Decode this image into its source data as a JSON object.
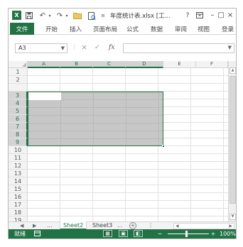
{
  "window": {
    "title": "年度统计表.xlsx [工...",
    "help": "?",
    "minimize": "–",
    "restore": "□",
    "close": "×"
  },
  "quick_access": {
    "logo": "X"
  },
  "ribbon": {
    "tabs": [
      "文件",
      "开始",
      "插入",
      "页面布局",
      "公式",
      "数据",
      "审阅",
      "视图",
      "登录"
    ]
  },
  "formula_bar": {
    "name_box": "A3",
    "cancel": "×",
    "enter": "✓",
    "fx": "fx",
    "formula_value": ""
  },
  "grid": {
    "columns": [
      "A",
      "B",
      "C",
      "D",
      "E",
      "F"
    ],
    "rows": [
      "1",
      "2",
      "3",
      "4",
      "5",
      "6",
      "7",
      "8",
      "9",
      "10",
      "11",
      "12",
      "13",
      "14",
      "15",
      "16",
      "17",
      "18",
      "19"
    ],
    "selected_range": "A3:D9",
    "active_cell": "A3"
  },
  "sheets": {
    "nav_prev": "◀",
    "nav_next": "▶",
    "more_left": "...",
    "tabs": [
      "Sheet2",
      "Sheet3"
    ],
    "more_right": "...",
    "active": "Sheet2",
    "add": "+"
  },
  "status": {
    "text": "就绪",
    "zoom_minus": "−",
    "zoom_plus": "+",
    "zoom": "100%",
    "accent": "#217346"
  }
}
